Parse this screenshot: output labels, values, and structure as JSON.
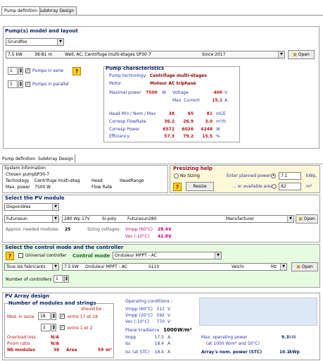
{
  "top": {
    "tabs": [
      "Pump definition",
      "SubArray Design"
    ],
    "section_title": "Pump(s) model and layout",
    "manufacturer": "Grundfos",
    "pump_list": {
      "power": "7.5 kW",
      "head": "38-81 m",
      "desc": "Well, AC, Centrifuge multi-étages  SP30-7",
      "since": "Since 2017"
    },
    "open_label": "Open",
    "series_value": "1",
    "series_label": "Pumps in serie",
    "parallel_value": "1",
    "parallel_label": "Pumps in parallel",
    "char_title": "Pump characteristics",
    "tech_label": "Pump technology",
    "tech_value": "Centrifuge multi-étages",
    "motor_label": "Motor",
    "motor_value": "Moteur AC triphasé",
    "maxpow_label": "Maximal power",
    "maxpow_value": "7500",
    "maxpow_unit": "W",
    "voltage_label": "Voltage",
    "voltage_value": "400",
    "voltage_unit": "V",
    "maxcur_label": "Max. Current",
    "maxcur_value": "15.1",
    "maxcur_unit": "A",
    "table": {
      "header": "Head  Min / Nom / Max",
      "header_vals": [
        "38",
        "65",
        "81"
      ],
      "header_unit": "mCE",
      "rows": [
        {
          "label": "Corresp FlowRate",
          "vals": [
            "36.2",
            "26.9",
            "3.0"
          ],
          "unit": "m³/h"
        },
        {
          "label": "Corresp Power",
          "vals": [
            "6572",
            "6026",
            "4248"
          ],
          "unit": "W"
        },
        {
          "label": "Efficiency",
          "vals": [
            "57.3",
            "79.2",
            "15.5"
          ],
          "unit": "%"
        }
      ]
    },
    "help": "?"
  },
  "bottom": {
    "tabs": [
      "Pump definition",
      "SubArray Design"
    ],
    "sysinfo": {
      "title": "System information",
      "chosen_label": "Chosen pump",
      "chosen_value": "SP30-7",
      "tech_label": "Technology",
      "tech_value": "Centrifuge multi-étag",
      "head_label": "Head",
      "headrange_label": "HeadRange",
      "maxpow_label": "Max. power",
      "maxpow_value": "7500 W",
      "flow_label": "Flow Rate"
    },
    "presizing": {
      "title": "Presizing help",
      "nosizing": "No Sizing",
      "enter_label": "Enter planned power",
      "enter_value": "7.1",
      "enter_unit": "kWp,",
      "area_label": "... or available area",
      "area_value": "82",
      "area_unit": "m²",
      "resize": "Resize"
    },
    "pv": {
      "title": "Select the PV module",
      "filter": "Disponibles",
      "manufacturer": "Futurasun",
      "module": "280 Wp 17V",
      "tech": "Si-poly",
      "model": "Futurasun280",
      "source": "Manufacturer",
      "open": "Open",
      "approx_label": "Approx. needed modules",
      "approx_value": "25",
      "sizing_label": "Sizing voltages:",
      "vmpp_label": "Vmpp (60°C)",
      "vmpp_value": "28.4",
      "vmpp_unit": "V",
      "voc_label": "Voc (-10°C)",
      "voc_value": "42.8",
      "voc_unit": "V"
    },
    "control": {
      "title": "Select the control mode and the controller",
      "universal": "Universal controller",
      "mode_label": "Control mode",
      "mode_value": "Onduleur MPPT - AC",
      "filter": "Tous les fabricants",
      "power": "7.5 kW",
      "device": "Onduleur MPPT - AC",
      "model": "S110",
      "brand": "Veichi",
      "mz": "Mz",
      "open": "Open",
      "nctrl_label": "Number of controllers",
      "nctrl_value": "1"
    },
    "design": {
      "title": "PV Array design",
      "group_title": "Number of modules and strings",
      "should_be": "should be :",
      "modserie_label": "Mod. in serie",
      "modserie_value": "18",
      "modserie_check": "entre 17 et 18",
      "strings_value": "2",
      "strings_check": "entre 1 et 2",
      "overload_label": "Overload loss",
      "overload_value": "N/A",
      "pnom_label": "Pnom ratio",
      "pnom_value": "N/A",
      "nbmod_label": "Nb modules",
      "nbmod_value": "36",
      "area_label": "Area",
      "area_value": "59",
      "area_unit": "m²",
      "opcond_title": "Operating conditions :",
      "cond": [
        {
          "label": "Vmpp (60°C)",
          "value": "511",
          "unit": "V"
        },
        {
          "label": "Vmpp (20°C)",
          "value": "592",
          "unit": "V"
        },
        {
          "label": "Voc (-10°C)",
          "value": "770",
          "unit": "V"
        }
      ],
      "irr_label": "Plane irradiance",
      "irr_value": "1000",
      "irr_unit": "W/m²",
      "impp_label": "Impp",
      "impp_value": "17.5",
      "impp_unit": "A",
      "isc_label": "Isc",
      "isc_value": "18.4",
      "isc_unit": "A",
      "iscstc_label": "Isc (at STC)",
      "iscstc_value": "18.4",
      "iscstc_unit": "A",
      "maxop_label": "Max. operating power",
      "maxop_value": "9.3",
      "maxop_unit": "kW",
      "maxop_sub": "(at 1000 W/m² and 50°C)",
      "nompow_label": "Array's nom. power (STC)",
      "nompow_value": "10.1",
      "nompow_unit": "kWp"
    },
    "help": "?"
  }
}
